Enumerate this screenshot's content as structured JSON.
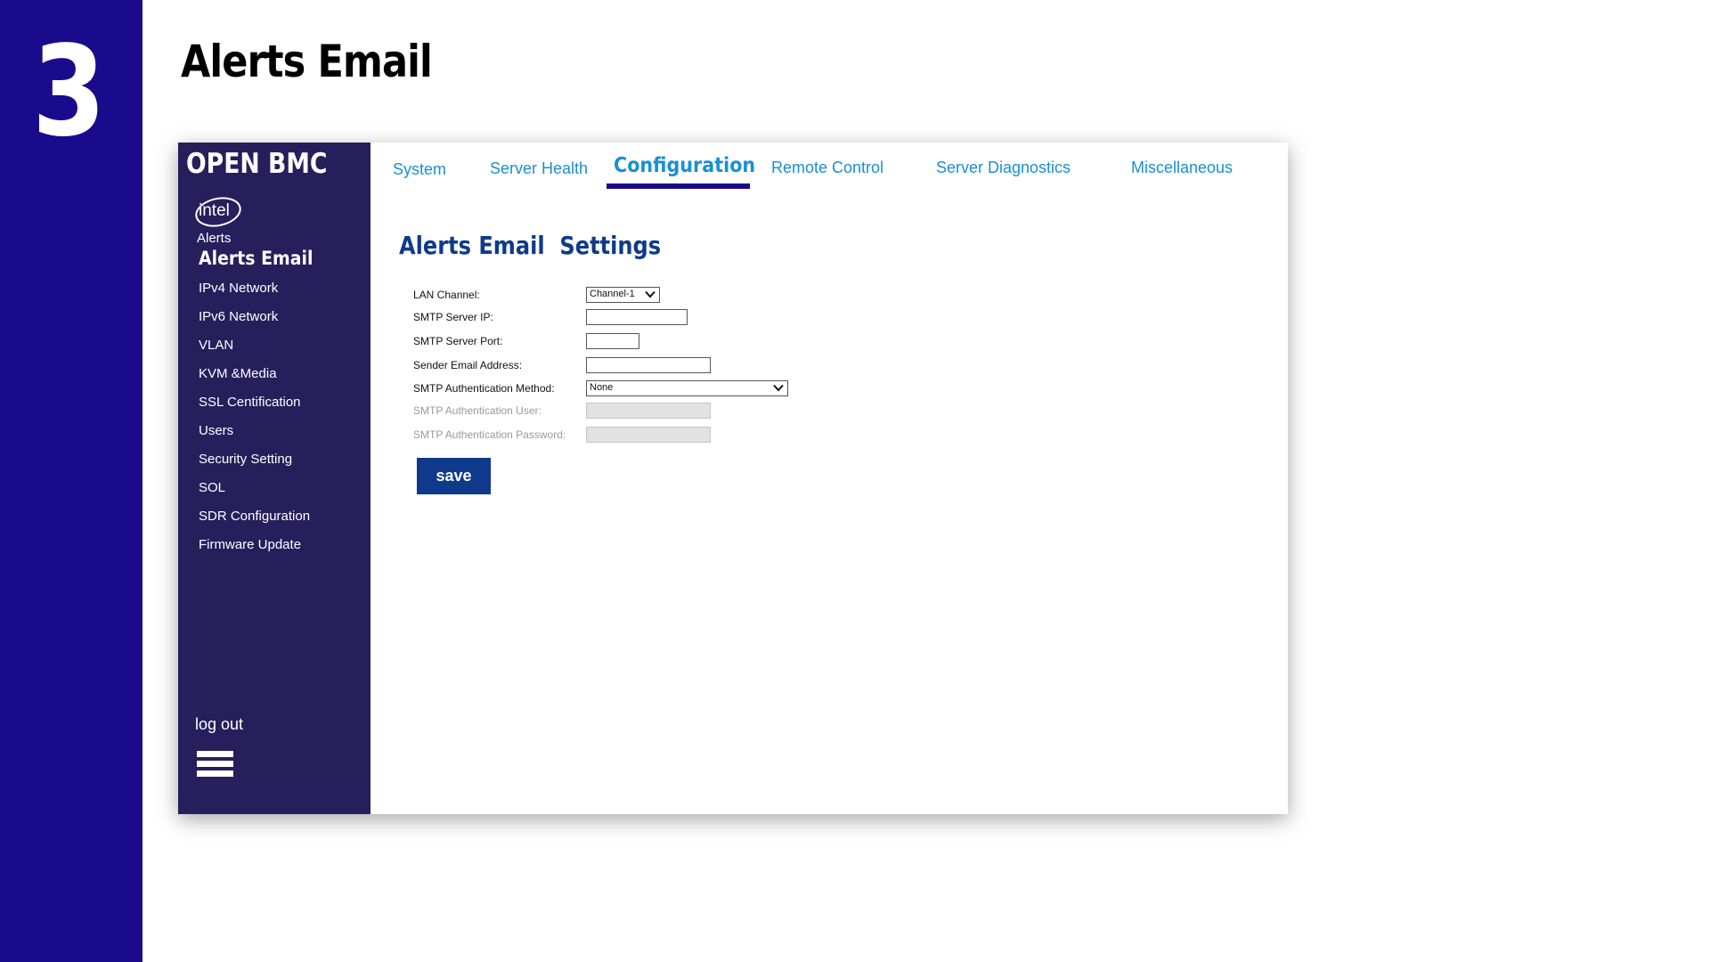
{
  "slide": {
    "step_number": "3",
    "title": "Alerts Email"
  },
  "app": {
    "brand": "OPEN BMC",
    "logo_text": "intel"
  },
  "top_tabs": [
    {
      "label": "System"
    },
    {
      "label": "Server Health"
    },
    {
      "label": "Configuration",
      "active": true
    },
    {
      "label": "Remote Control"
    },
    {
      "label": "Server Diagnostics"
    },
    {
      "label": "Miscellaneous"
    }
  ],
  "sidebar": {
    "items": [
      {
        "label": "Alerts"
      },
      {
        "label": "Alerts Email",
        "active": true
      },
      {
        "label": "IPv4 Network"
      },
      {
        "label": "IPv6 Network"
      },
      {
        "label": "VLAN"
      },
      {
        "label": "KVM &Media"
      },
      {
        "label": "SSL Centification"
      },
      {
        "label": "Users"
      },
      {
        "label": "Security Setting"
      },
      {
        "label": "SOL"
      },
      {
        "label": "SDR Configuration"
      },
      {
        "label": "Firmware Update"
      }
    ],
    "logout_label": "log out",
    "menu_icon": "hamburger-menu-icon"
  },
  "settings": {
    "title": "Alerts Email  Settings",
    "fields": [
      {
        "label": "LAN Channel:",
        "value": "Channel-1"
      },
      {
        "label": "SMTP Server IP:",
        "value": ""
      },
      {
        "label": "SMTP Server Port:",
        "value": ""
      },
      {
        "label": "Sender Email Address:",
        "value": ""
      },
      {
        "label": "SMTP Authentication Method:",
        "value": "None"
      },
      {
        "label": "SMTP Authentication User:",
        "value": "",
        "disabled": true
      },
      {
        "label": "SMTP Authentication Password:",
        "value": "",
        "disabled": true
      }
    ],
    "save_label": "save"
  },
  "colors": {
    "band": "#1a0a8c",
    "sidebar": "#271f5c",
    "tab_text": "#1a8fd4",
    "heading": "#0f3a8c",
    "button": "#0f3a8c"
  }
}
